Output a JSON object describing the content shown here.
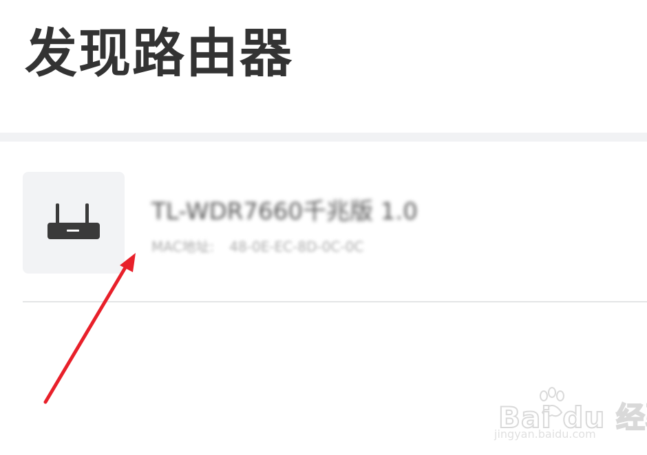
{
  "header": {
    "title": "发现路由器"
  },
  "router_list": [
    {
      "icon": "router-icon",
      "name": "TL-WDR7660千兆版 1.0",
      "mac_label": "MAC地址:",
      "mac_value": "48-0E-EC-8D-0C-0C"
    }
  ],
  "annotation": {
    "arrow_color": "#e8202a"
  },
  "watermark": {
    "logo_text": "Bai du 经验",
    "url": "jingyan.baidu.com"
  },
  "colors": {
    "title": "#333333",
    "divider": "#f1f2f4",
    "icon_bg": "#f2f3f5",
    "icon_fg": "#3a3a3a"
  }
}
